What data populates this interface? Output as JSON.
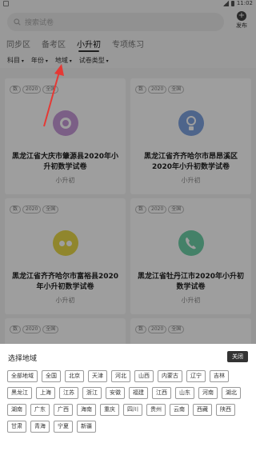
{
  "status": {
    "time": "11:02"
  },
  "search": {
    "placeholder": "搜索试卷"
  },
  "publish": {
    "label": "发布"
  },
  "tabs": [
    {
      "label": "同步区",
      "active": false
    },
    {
      "label": "备考区",
      "active": false
    },
    {
      "label": "小升初",
      "active": true
    },
    {
      "label": "专项练习",
      "active": false
    }
  ],
  "filters": [
    "科目",
    "年份",
    "地域",
    "试卷类型"
  ],
  "cards": [
    {
      "tags": [
        "数",
        "2020",
        "全国"
      ],
      "title": "黑龙江省大庆市肇源县2020年小升初数学试卷",
      "sub": "小升初",
      "icon_color": "#c79ad8",
      "icon": "circle"
    },
    {
      "tags": [
        "数",
        "2020",
        "全国"
      ],
      "title": "黑龙江省齐齐哈尔市昂昂溪区2020年小升初数学试卷",
      "sub": "小升初",
      "icon_color": "#7fa3e0",
      "icon": "bulb"
    },
    {
      "tags": [
        "数",
        "2020",
        "全国"
      ],
      "title": "黑龙江省齐齐哈尔市富裕县2020年小升初数学试卷",
      "sub": "小升初",
      "icon_color": "#e8d84a",
      "icon": "dots"
    },
    {
      "tags": [
        "数",
        "2020",
        "全国"
      ],
      "title": "黑龙江省牡丹江市2020年小升初数学试卷",
      "sub": "小升初",
      "icon_color": "#6fd0a8",
      "icon": "phone"
    },
    {
      "tags": [
        "数",
        "2020",
        "全国"
      ],
      "title": "",
      "sub": "",
      "icon_color": "#7fa3e0",
      "icon": "none"
    },
    {
      "tags": [
        "数",
        "2020",
        "全国"
      ],
      "title": "",
      "sub": "",
      "icon_color": "#e39acb",
      "icon": "none"
    }
  ],
  "sheet": {
    "title": "选择地域",
    "close": "关闭",
    "regions": [
      "全部地域",
      "全国",
      "北京",
      "天津",
      "河北",
      "山西",
      "内蒙古",
      "辽宁",
      "吉林",
      "黑龙江",
      "上海",
      "江苏",
      "浙江",
      "安徽",
      "福建",
      "江西",
      "山东",
      "河南",
      "湖北",
      "湖南",
      "广东",
      "广西",
      "海南",
      "重庆",
      "四川",
      "贵州",
      "云南",
      "西藏",
      "陕西",
      "甘肃",
      "青海",
      "宁夏",
      "新疆"
    ]
  },
  "colors": {
    "overlay": "rgba(0,0,0,0.38)",
    "arrow": "#e53935"
  }
}
